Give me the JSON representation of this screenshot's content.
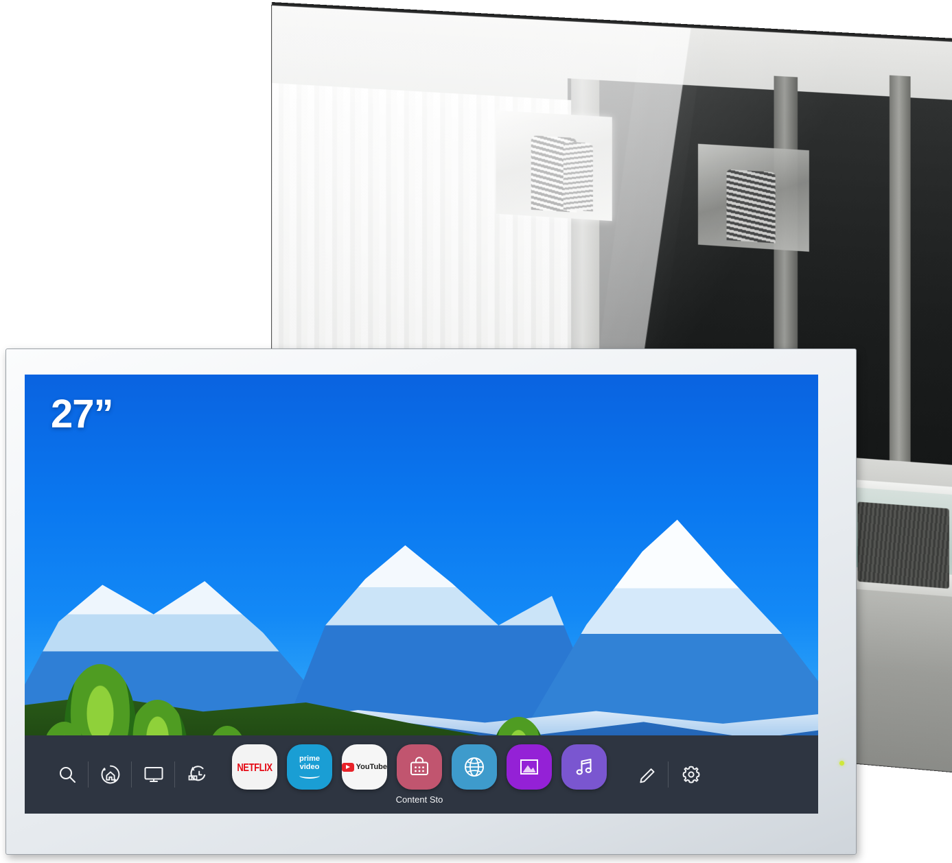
{
  "product": {
    "mirror_panel": {
      "name": "mirror-tv-angled-panel",
      "scene_description": "Greyscale reflection of a spa bathroom with curtains, bathtub and wall-mounted TV"
    },
    "smart_tv": {
      "size_badge": "27”",
      "wallpaper_description": "Snow-capped mountain range under blue sky with green meadow and trees"
    }
  },
  "launcher": {
    "background_color": "#2e3541",
    "system_buttons": [
      {
        "name": "search-icon",
        "label": "Search"
      },
      {
        "name": "home-dashboard-icon",
        "label": "Home Dashboard"
      },
      {
        "name": "tv-input-icon",
        "label": "Inputs"
      },
      {
        "name": "recents-icon",
        "label": "Recents"
      }
    ],
    "apps": [
      {
        "name": "netflix",
        "label": "NETFLIX",
        "tile_color": "#f3f3f3"
      },
      {
        "name": "prime-video",
        "label_line1": "prime",
        "label_line2": "video",
        "tile_color": "#1a9ed4"
      },
      {
        "name": "youtube",
        "label": "YouTube",
        "tile_color": "#f6f6f6"
      },
      {
        "name": "content-store",
        "label": "Content Sto",
        "tile_color": "#c1556f"
      },
      {
        "name": "web-browser",
        "label": "",
        "tile_color": "#3e9bcc"
      },
      {
        "name": "photo-video",
        "label": "",
        "tile_color": "#9421d6"
      },
      {
        "name": "music",
        "label": "",
        "tile_color": "#7a56d0"
      }
    ],
    "right_buttons": [
      {
        "name": "edit-icon",
        "label": "Edit"
      },
      {
        "name": "settings-icon",
        "label": "Settings"
      }
    ]
  },
  "colors": {
    "sky_blue": "#0a78f0",
    "bar_dark": "#2e3541",
    "netflix_red": "#e50914",
    "prime_blue": "#1a9ed4",
    "store_pink": "#c1556f",
    "browser_blue": "#3e9bcc",
    "photo_purple": "#9421d6",
    "music_purple": "#7a56d0",
    "led_green": "#cfe83a"
  }
}
